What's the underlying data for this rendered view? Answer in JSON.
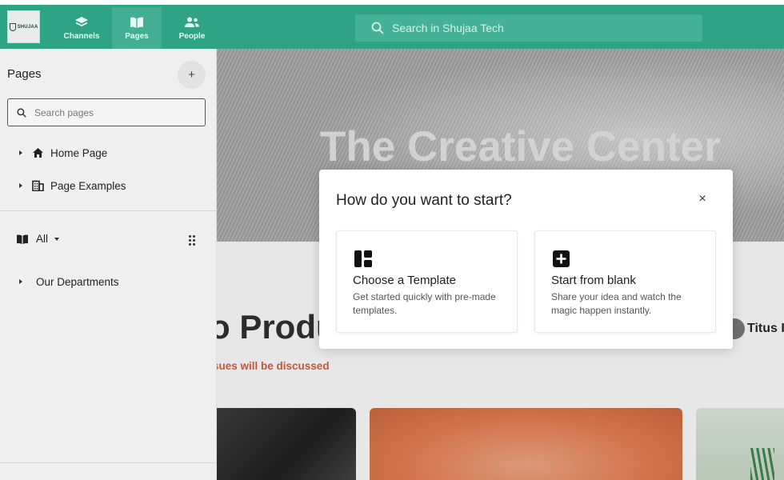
{
  "topbar": {
    "logo_text": "SHUJAA",
    "nav": [
      {
        "label": "Channels",
        "icon": "layers-icon"
      },
      {
        "label": "Pages",
        "icon": "book-open-icon",
        "active": true
      },
      {
        "label": "People",
        "icon": "people-icon"
      }
    ],
    "search_placeholder": "Search in Shujaa Tech",
    "color": "#2fa386"
  },
  "sidebar": {
    "title": "Pages",
    "add_label": "+",
    "search_placeholder": "Search pages",
    "tree": [
      {
        "label": "Home Page",
        "icon": "home-icon"
      },
      {
        "label": "Page Examples",
        "icon": "building-icon"
      }
    ],
    "filter_label": "All",
    "groups": [
      {
        "label": "Our Departments"
      }
    ]
  },
  "background": {
    "hero_title": "The Creative Center",
    "heading_partial": "o Produ",
    "subline_partial": "sues will be discussed",
    "author_partial": "Titus I"
  },
  "modal": {
    "title": "How do you want to start?",
    "close_label": "×",
    "options": [
      {
        "title": "Choose a Template",
        "description": "Get started quickly with pre-made templates.",
        "icon": "template-layout-icon"
      },
      {
        "title": "Start from blank",
        "description": "Share your idea and watch the magic happen instantly.",
        "icon": "plus-square-icon"
      }
    ]
  }
}
